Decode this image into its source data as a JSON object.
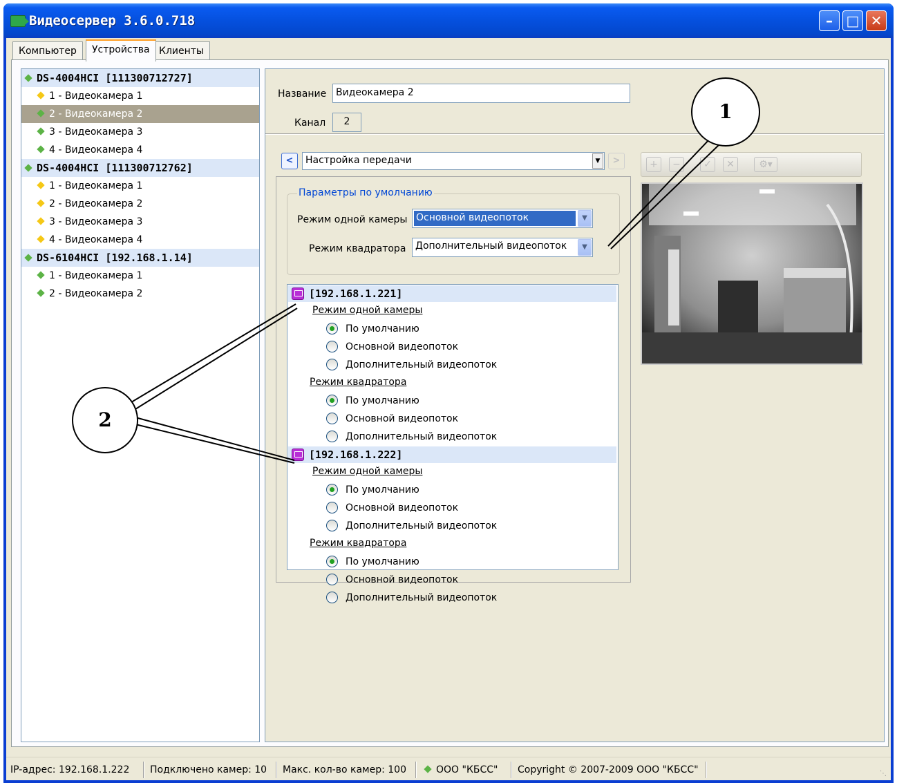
{
  "window": {
    "title": "Видеосервер 3.6.0.718"
  },
  "tabs": [
    {
      "label": "Компьютер",
      "active": false
    },
    {
      "label": "Устройства",
      "active": true
    },
    {
      "label": "Клиенты",
      "active": false
    }
  ],
  "tree": {
    "items": [
      {
        "label": "DS-4004HCI [111300712727]",
        "type": "device",
        "icon": "green-diamond"
      },
      {
        "label": "1 - Видеокамера 1",
        "type": "camera",
        "icon": "yellow-diamond"
      },
      {
        "label": "2 - Видеокамера 2",
        "type": "camera",
        "icon": "green-diamond",
        "selected": true
      },
      {
        "label": "3 - Видеокамера 3",
        "type": "camera",
        "icon": "green-diamond"
      },
      {
        "label": "4 - Видеокамера 4",
        "type": "camera",
        "icon": "green-diamond"
      },
      {
        "label": "DS-4004HCI [111300712762]",
        "type": "device",
        "icon": "green-diamond"
      },
      {
        "label": "1 - Видеокамера 1",
        "type": "camera",
        "icon": "yellow-diamond"
      },
      {
        "label": "2 - Видеокамера 2",
        "type": "camera",
        "icon": "yellow-diamond"
      },
      {
        "label": "3 - Видеокамера 3",
        "type": "camera",
        "icon": "yellow-diamond"
      },
      {
        "label": "4 - Видеокамера 4",
        "type": "camera",
        "icon": "yellow-diamond"
      },
      {
        "label": "DS-6104HCI [192.168.1.14]",
        "type": "device",
        "icon": "green-diamond"
      },
      {
        "label": "1 - Видеокамера 1",
        "type": "camera",
        "icon": "green-diamond"
      },
      {
        "label": "2 - Видеокамера 2",
        "type": "camera",
        "icon": "green-diamond"
      }
    ]
  },
  "form": {
    "name_label": "Название",
    "name_value": "Видеокамера 2",
    "channel_label": "Канал",
    "channel_value": "2"
  },
  "settings": {
    "section_value": "Настройка передачи",
    "defaults_title": "Параметры по умолчанию",
    "single_mode_label": "Режим одной камеры",
    "single_mode_value": "Основной видеопоток",
    "quad_mode_label": "Режим квадратора",
    "quad_mode_value": "Дополнительный видеопоток"
  },
  "cameras": [
    {
      "address": "[192.168.1.221]",
      "single_title": "Режим одной камеры",
      "single_options": [
        "По умолчанию",
        "Основной видеопоток",
        "Дополнительный видеопоток"
      ],
      "single_selected": 0,
      "quad_title": "Режим квадратора",
      "quad_options": [
        "По умолчанию",
        "Основной видеопоток",
        "Дополнительный видеопоток"
      ],
      "quad_selected": 0
    },
    {
      "address": "[192.168.1.222]",
      "single_title": "Режим одной камеры",
      "single_options": [
        "По умолчанию",
        "Основной видеопоток",
        "Дополнительный видеопоток"
      ],
      "single_selected": 0,
      "quad_title": "Режим квадратора",
      "quad_options": [
        "По умолчанию",
        "Основной видеопоток",
        "Дополнительный видеопоток"
      ],
      "quad_selected": 0
    }
  ],
  "callouts": {
    "one": "1",
    "two": "2"
  },
  "status": {
    "ip": "IP-адрес: 192.168.1.222",
    "connected": "Подключено камер: 10",
    "max": "Макс. кол-во камер: 100",
    "company": "ООО \"КБСС\"",
    "copyright": "Copyright © 2007-2009 ООО \"КБСС\""
  },
  "colors": {
    "titlebar": "#0550de",
    "selection": "#a9a28f",
    "device_row": "#dbe7f8",
    "group_title": "#0046d5"
  }
}
